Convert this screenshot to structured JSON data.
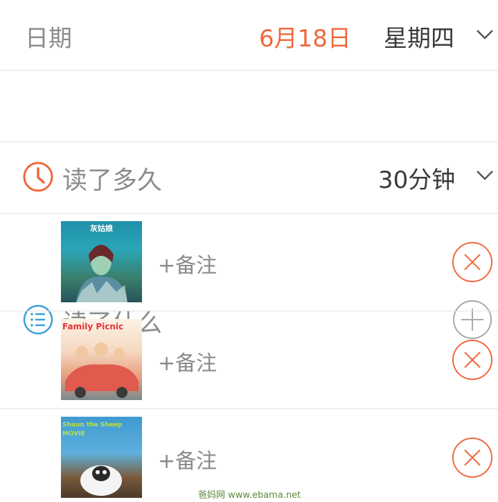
{
  "date_row": {
    "label": "日期",
    "date": "6月18日",
    "weekday": "星期四"
  },
  "duration_row": {
    "label": "读了多久",
    "value": "30分钟"
  },
  "books_row": {
    "label": "读了什么"
  },
  "books": [
    {
      "cover_title": "灰姑娘",
      "note_label": "+备注"
    },
    {
      "cover_title": "Family Picnic",
      "note_label": "+备注"
    },
    {
      "cover_title": "Shaun the Sheep MOVIE",
      "note_label": "+备注"
    }
  ],
  "watermark": "爸妈网 www.ebama.net",
  "colors": {
    "accent_orange": "#f0683c",
    "accent_blue": "#3aa0d8",
    "divider": "#e2e2e2"
  }
}
